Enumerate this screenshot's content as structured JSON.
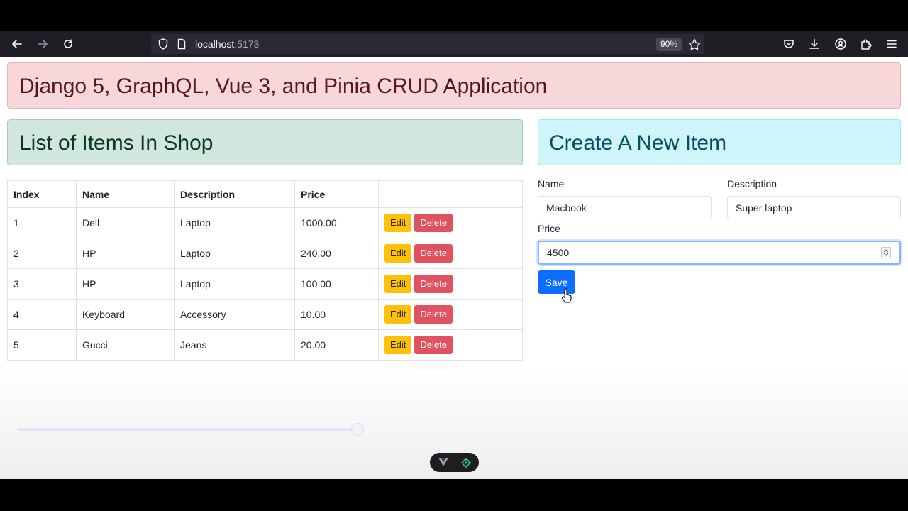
{
  "browser": {
    "url_host": "localhost",
    "url_port": ":5173",
    "zoom": "90%"
  },
  "header": {
    "title": "Django 5, GraphQL, Vue 3, and Pinia CRUD Application"
  },
  "list": {
    "title": "List of Items In Shop",
    "columns": [
      "Index",
      "Name",
      "Description",
      "Price",
      ""
    ],
    "rows": [
      {
        "index": "1",
        "name": "Dell",
        "description": "Laptop",
        "price": "1000.00"
      },
      {
        "index": "2",
        "name": "HP",
        "description": "Laptop",
        "price": "240.00"
      },
      {
        "index": "3",
        "name": "HP",
        "description": "Laptop",
        "price": "100.00"
      },
      {
        "index": "4",
        "name": "Keyboard",
        "description": "Accessory",
        "price": "10.00"
      },
      {
        "index": "5",
        "name": "Gucci",
        "description": "Jeans",
        "price": "20.00"
      }
    ],
    "edit_label": "Edit",
    "delete_label": "Delete"
  },
  "form": {
    "title": "Create A New Item",
    "name_label": "Name",
    "name_value": "Macbook",
    "description_label": "Description",
    "description_value": "Super laptop",
    "price_label": "Price",
    "price_value": "4500",
    "save_label": "Save"
  },
  "colors": {
    "danger_bg": "#f8d7da",
    "success_bg": "#d1e7dd",
    "info_bg": "#cff4fc",
    "primary": "#0d6efd",
    "warning": "#ffc107",
    "danger": "#dc3545"
  }
}
